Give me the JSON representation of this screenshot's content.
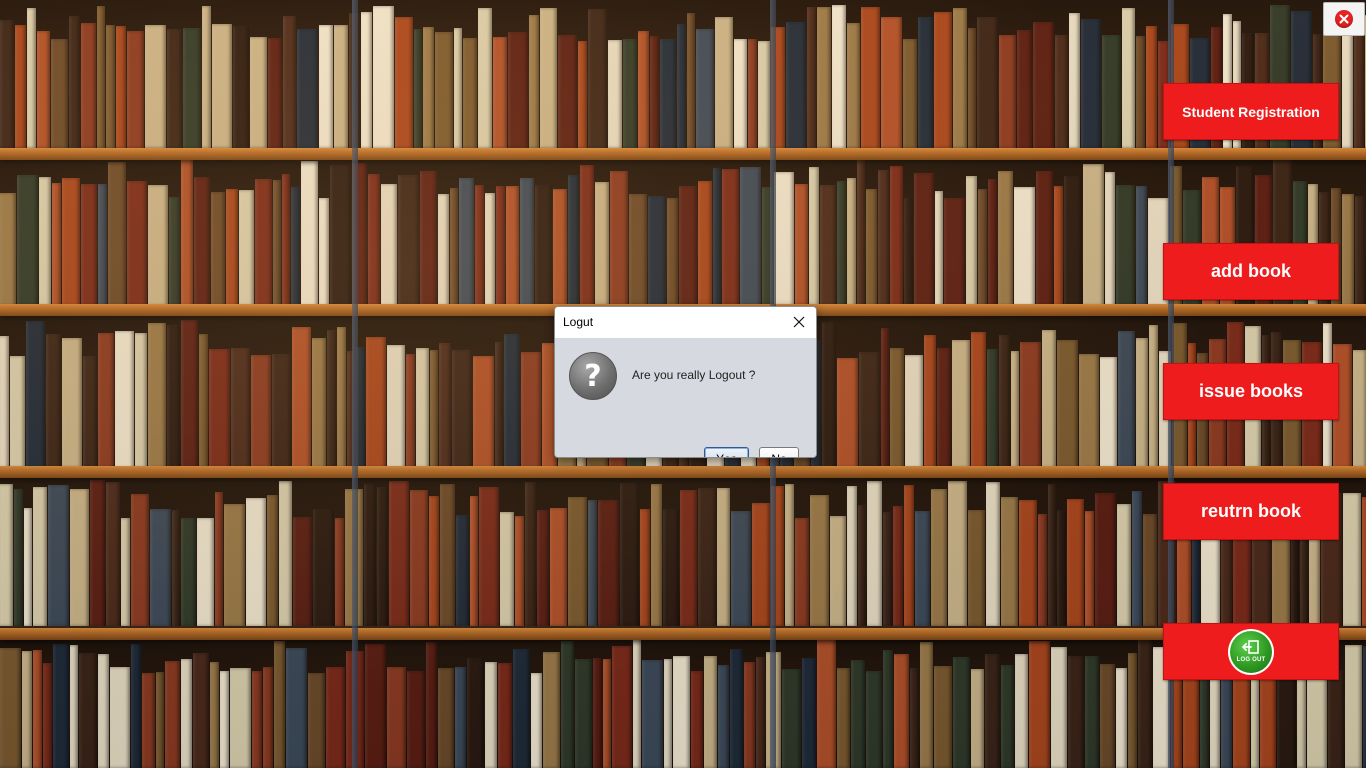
{
  "window": {
    "close_icon": "close-icon",
    "close_color": "#e52222"
  },
  "side_menu": {
    "accent_color": "#ee1c1c",
    "student_registration": "Student Registration",
    "add_book": "add book",
    "issue_books": "issue books",
    "return_book": "reutrn book",
    "logout_icon_text": "LOG OUT"
  },
  "dialog": {
    "title": "Logut",
    "message": "Are you really Logout ?",
    "icon": "question-icon",
    "yes_first": "Y",
    "yes_rest": "es",
    "no_first": "N",
    "no_rest": "o"
  }
}
